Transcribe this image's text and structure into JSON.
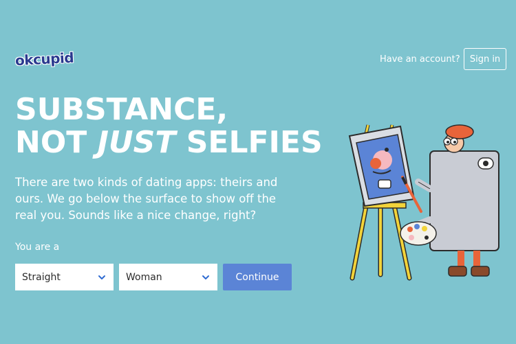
{
  "header": {
    "logo_text": "okcupid",
    "account_prompt": "Have an account?",
    "signin_label": "Sign in"
  },
  "hero": {
    "headline_line1": "SUBSTANCE,",
    "headline_line2_prefix": "NOT ",
    "headline_line2_emph": "JUST",
    "headline_line2_suffix": " SELFIES",
    "subtext": "There are two kinds of dating apps: theirs and ours. We go below the surface to show off the real you. Sounds like a nice change, right?"
  },
  "form": {
    "you_are_label": "You are a",
    "orientation_value": "Straight",
    "gender_value": "Woman",
    "continue_label": "Continue"
  },
  "colors": {
    "background": "#7ec4cf",
    "button_blue": "#5b84d6",
    "logo_navy": "#2a3a8f"
  },
  "icons": {
    "dropdown": "chevron-down-icon",
    "illustration": "painter-phone-illustration"
  }
}
